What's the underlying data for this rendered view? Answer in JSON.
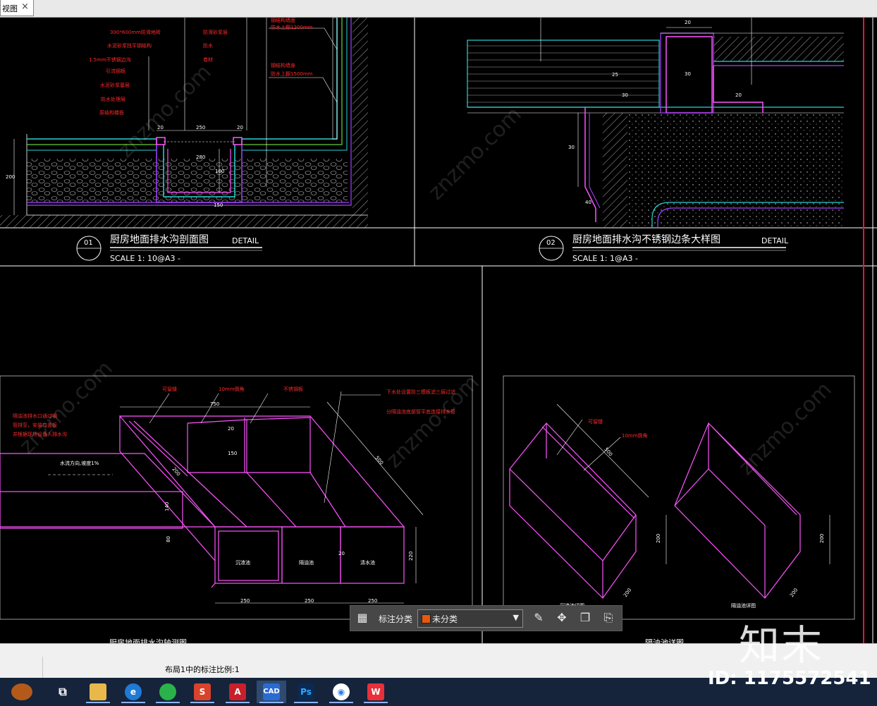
{
  "window": {
    "tab_title": "视图",
    "tab_close": "×"
  },
  "drawing": {
    "d1": {
      "num": "01",
      "title": "厨房地面排水沟剖面图",
      "detail": "DETAIL",
      "scale": "SCALE  1:  10@A3   -"
    },
    "d2": {
      "num": "02",
      "title": "厨房地面排水沟不锈钢边条大样图",
      "detail": "DETAIL",
      "scale": "SCALE  1:  1@A3   -"
    },
    "d1_labels": [
      "300*600mm防滑地砖",
      "水泥砂浆找平钢结构",
      "1.5mm不锈钢边沟",
      "引流钢板",
      "水泥砂浆基层",
      "防水处理层",
      "原结构楼板"
    ],
    "d1_right_labels": [
      "防滑砂浆层",
      "防水",
      "卷材"
    ],
    "d1_red_right": [
      "钢结构墙面",
      "防水上翻1200mm",
      "钢结构墙身",
      "防水上翻1500mm"
    ],
    "d1_dims": [
      "250",
      "20",
      "20",
      "280",
      "100",
      "150",
      "200"
    ],
    "d2_dims": [
      "20",
      "25",
      "30",
      "30",
      "20",
      "30",
      "40"
    ],
    "iso_notes": [
      "可留缝",
      "10mm倒角",
      "不锈钢板"
    ],
    "iso_right_notes": [
      "下水处设置防三模板滤三层过滤",
      "分隔油池底部管平底连接排水管"
    ],
    "iso_left_notes": [
      "隔油池排水口通过钢",
      "管排至，安装口盖板",
      "并根据现场设备入排水沟"
    ],
    "iso_slope": "水流方向,坡度1%",
    "iso_dims": [
      "750",
      "20",
      "150",
      "200",
      "140",
      "80",
      "500",
      "220",
      "250",
      "250",
      "250",
      "20"
    ],
    "iso_boxes": [
      "沉渣池",
      "隔油池",
      "清水池"
    ],
    "iso2_notes": [
      "可留缝",
      "10mm倒角"
    ],
    "iso2_dims": [
      "500",
      "200",
      "200",
      "200",
      "200"
    ],
    "iso2_captions": [
      "沉渣池详图",
      "隔油池详图"
    ],
    "cut_captions": [
      "厨房地面排水沟轴测图",
      "隔油池详图"
    ],
    "watermark_text": "znzmo.com"
  },
  "toolbar": {
    "label": "标注分类",
    "selected": "未分类",
    "swatch_color": "#e8580c"
  },
  "status": {
    "text": "布局1中的标注比例:1"
  },
  "taskbar": {
    "apps": [
      "文件资源管理器",
      "IE浏览器",
      "微信",
      "WPS演示",
      "AutoCAD",
      "CAD",
      "Photoshop",
      "百度网盘",
      "WPS"
    ]
  },
  "watermark": {
    "logo": "知末",
    "id": "ID: 1175572541"
  }
}
